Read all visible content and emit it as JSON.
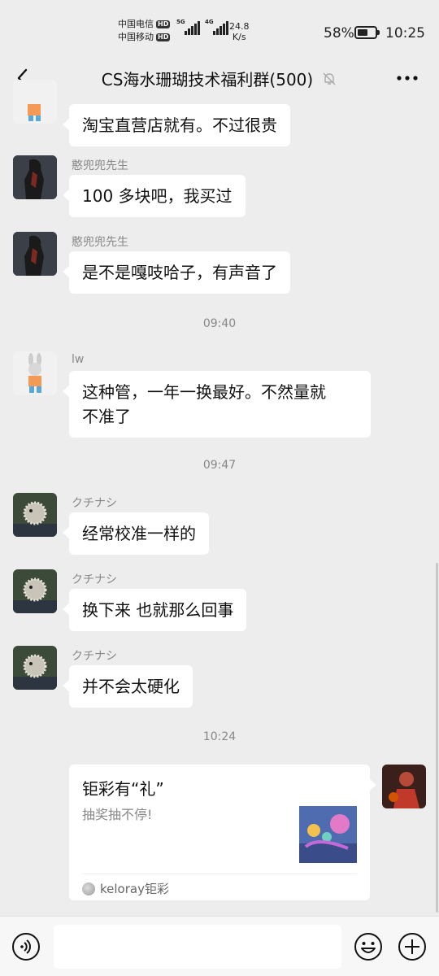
{
  "status_bar": {
    "carrier1": "中国电信",
    "carrier2": "中国移动",
    "hd": "HD",
    "net1": "5G",
    "net2": "4G",
    "speed_value": "24.8",
    "speed_unit": "K/s",
    "battery_percent": "58%",
    "battery_level": 0.58,
    "time": "10:25"
  },
  "header": {
    "title": "CS海水珊瑚技术福利群(500)",
    "back_icon": "chevron-left-icon",
    "mute_icon": "bell-off-icon",
    "more_icon": "more-dots-icon"
  },
  "messages": [
    {
      "sender": "",
      "text": "淘宝直营店就有。不过很贵",
      "avatar": "bunny"
    },
    {
      "sender": "憨兜兜先生",
      "text": "100 多块吧，我买过",
      "avatar": "dark-figure"
    },
    {
      "sender": "憨兜兜先生",
      "text": "是不是嘎吱哈子，有声音了",
      "avatar": "dark-figure"
    },
    {
      "time": "09:40"
    },
    {
      "sender": "lw",
      "text_line1": "这种管，一年一换最好。不然量就",
      "text_line2": "不准了",
      "avatar": "bunny"
    },
    {
      "time": "09:47"
    },
    {
      "sender": "クチナシ",
      "text": "经常校准一样的",
      "avatar": "pufferfish"
    },
    {
      "sender": "クチナシ",
      "text": "换下来  也就那么回事",
      "avatar": "pufferfish"
    },
    {
      "sender": "クチナシ",
      "text": "并不会太硬化",
      "avatar": "pufferfish"
    },
    {
      "time": "10:24"
    }
  ],
  "card": {
    "title": "钜彩有“礼”",
    "description": "抽奖抽不停!",
    "source": "keloray钜彩"
  },
  "input_bar": {
    "placeholder": "",
    "voice_icon": "voice-icon",
    "emoji_icon": "emoji-icon",
    "plus_icon": "plus-icon"
  }
}
